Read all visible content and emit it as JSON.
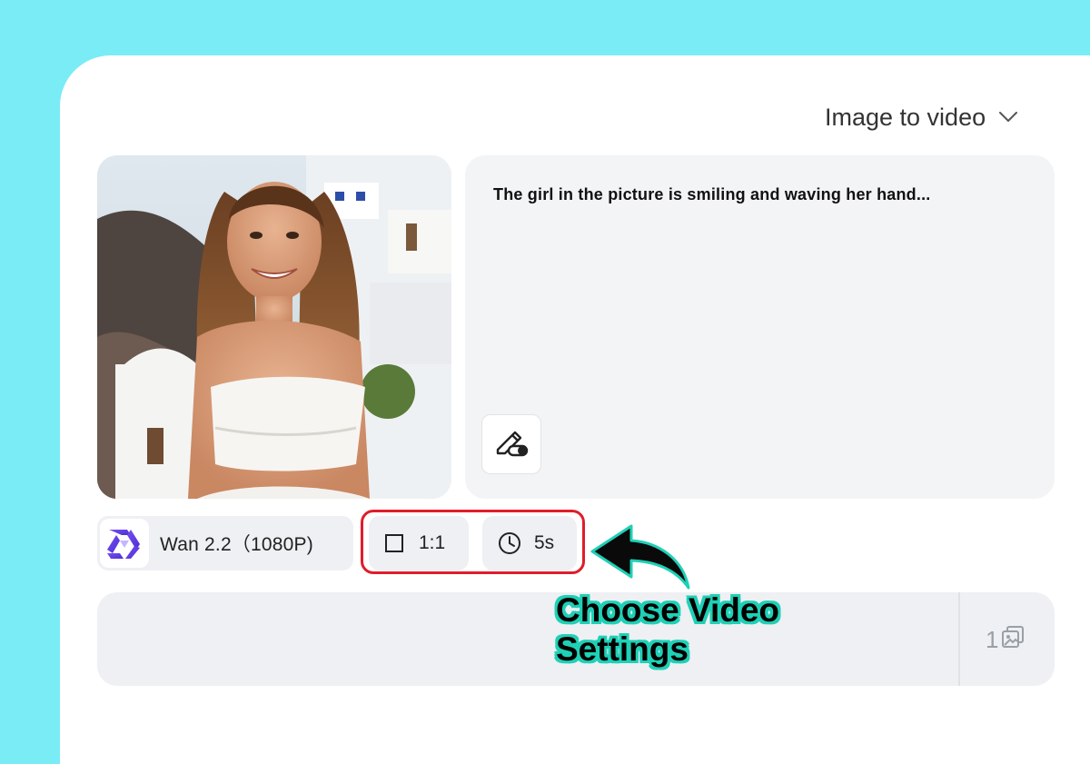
{
  "mode_selector": {
    "label": "Image to video",
    "icon": "chevron-down-icon"
  },
  "prompt": {
    "text": "The girl in the picture is smiling and waving her hand...",
    "tool_icon": "pencil-eraser-icon"
  },
  "photo": {
    "icon": "uploaded-image"
  },
  "model": {
    "label": "Wan 2.2（1080P)",
    "logo_icon": "wan-logo-icon"
  },
  "settings": {
    "aspect_ratio": {
      "label": "1:1",
      "icon": "square-icon"
    },
    "duration": {
      "label": "5s",
      "icon": "clock-icon"
    }
  },
  "generate": {
    "count": "1",
    "count_icon": "image-stack-icon"
  },
  "annotation": {
    "line1": "Choose Video",
    "line2": "Settings",
    "highlight_color": "#e01d2a",
    "outline_color": "#1fd0b6"
  },
  "colors": {
    "background": "#7aecf6",
    "card": "#ffffff",
    "chip": "#eef0f3"
  }
}
